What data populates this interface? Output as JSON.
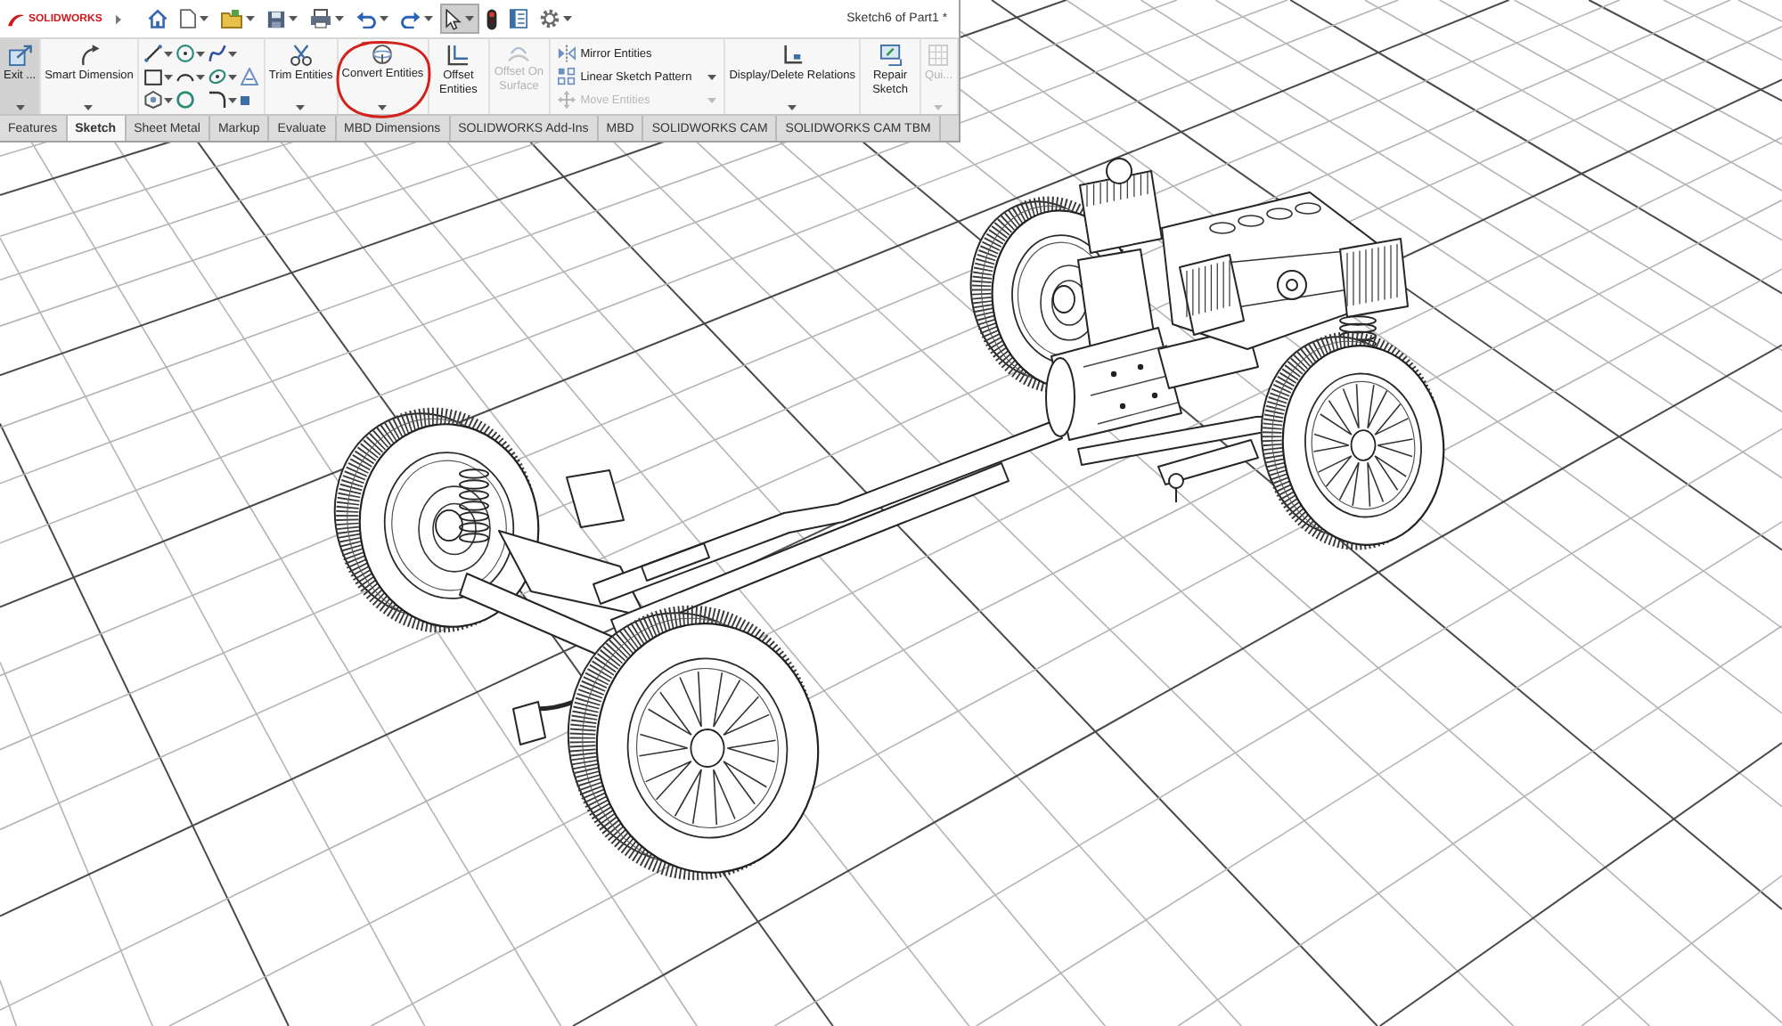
{
  "title_bar": {
    "logo": "SOLIDWORKS",
    "document_title": "Sketch6 of Part1 *"
  },
  "quick_access": [
    {
      "dropdown": false,
      "selected": false
    },
    {
      "dropdown": true,
      "selected": false
    },
    {
      "dropdown": true,
      "selected": false
    },
    {
      "dropdown": true,
      "selected": false
    },
    {
      "dropdown": true,
      "selected": false
    },
    {
      "dropdown": true,
      "selected": false
    },
    {
      "dropdown": true,
      "selected": false
    },
    {
      "dropdown": true,
      "selected": true
    },
    {
      "dropdown": false,
      "selected": false
    },
    {
      "dropdown": false,
      "selected": false
    },
    {
      "dropdown": true,
      "selected": false
    }
  ],
  "ribbon": [
    {
      "kind": "large",
      "label": "Exit ...",
      "active": true,
      "disabled": false,
      "dropdown": true,
      "highlighted": false
    },
    {
      "kind": "large",
      "label": "Smart Dimension",
      "active": false,
      "disabled": false,
      "dropdown": true,
      "highlighted": false
    },
    {
      "kind": "tools",
      "tools": [
        {
          "dropdown": true
        },
        {
          "dropdown": true
        },
        {
          "dropdown": true
        },
        {
          "dropdown": true
        },
        {
          "dropdown": true
        },
        {
          "dropdown": true
        },
        {
          "dropdown": false
        },
        {
          "dropdown": true
        },
        {
          "dropdown": false
        },
        {
          "dropdown": true
        },
        {
          "dropdown": false
        }
      ]
    },
    {
      "kind": "large",
      "label": "Trim Entities",
      "active": false,
      "disabled": false,
      "dropdown": true,
      "highlighted": false
    },
    {
      "kind": "large",
      "label": "Convert Entities",
      "active": false,
      "disabled": false,
      "dropdown": true,
      "highlighted": true
    },
    {
      "kind": "large",
      "label": "Offset Entities",
      "active": false,
      "disabled": false,
      "dropdown": false,
      "highlighted": false
    },
    {
      "kind": "large",
      "label": "Offset On Surface",
      "active": false,
      "disabled": true,
      "dropdown": false,
      "highlighted": false
    },
    {
      "kind": "stack",
      "items": [
        {
          "label": "Mirror Entities",
          "disabled": false,
          "dropdown": false
        },
        {
          "label": "Linear Sketch Pattern",
          "disabled": false,
          "dropdown": true
        },
        {
          "label": "Move Entities",
          "disabled": true,
          "dropdown": true
        }
      ]
    },
    {
      "kind": "large",
      "label": "Display/Delete Relations",
      "active": false,
      "disabled": false,
      "dropdown": true,
      "highlighted": false
    },
    {
      "kind": "large",
      "label": "Repair Sketch",
      "active": false,
      "disabled": false,
      "dropdown": false,
      "highlighted": false
    },
    {
      "kind": "large",
      "label": "Qui...",
      "active": false,
      "disabled": true,
      "dropdown": true,
      "highlighted": false
    }
  ],
  "tabs": [
    {
      "label": "Features",
      "selected": false
    },
    {
      "label": "Sketch",
      "selected": true
    },
    {
      "label": "Sheet Metal",
      "selected": false
    },
    {
      "label": "Markup",
      "selected": false
    },
    {
      "label": "Evaluate",
      "selected": false
    },
    {
      "label": "MBD Dimensions",
      "selected": false
    },
    {
      "label": "SOLIDWORKS Add-Ins",
      "selected": false
    },
    {
      "label": "MBD",
      "selected": false
    },
    {
      "label": "SOLIDWORKS CAM",
      "selected": false
    },
    {
      "label": "SOLIDWORKS CAM TBM",
      "selected": false
    }
  ]
}
